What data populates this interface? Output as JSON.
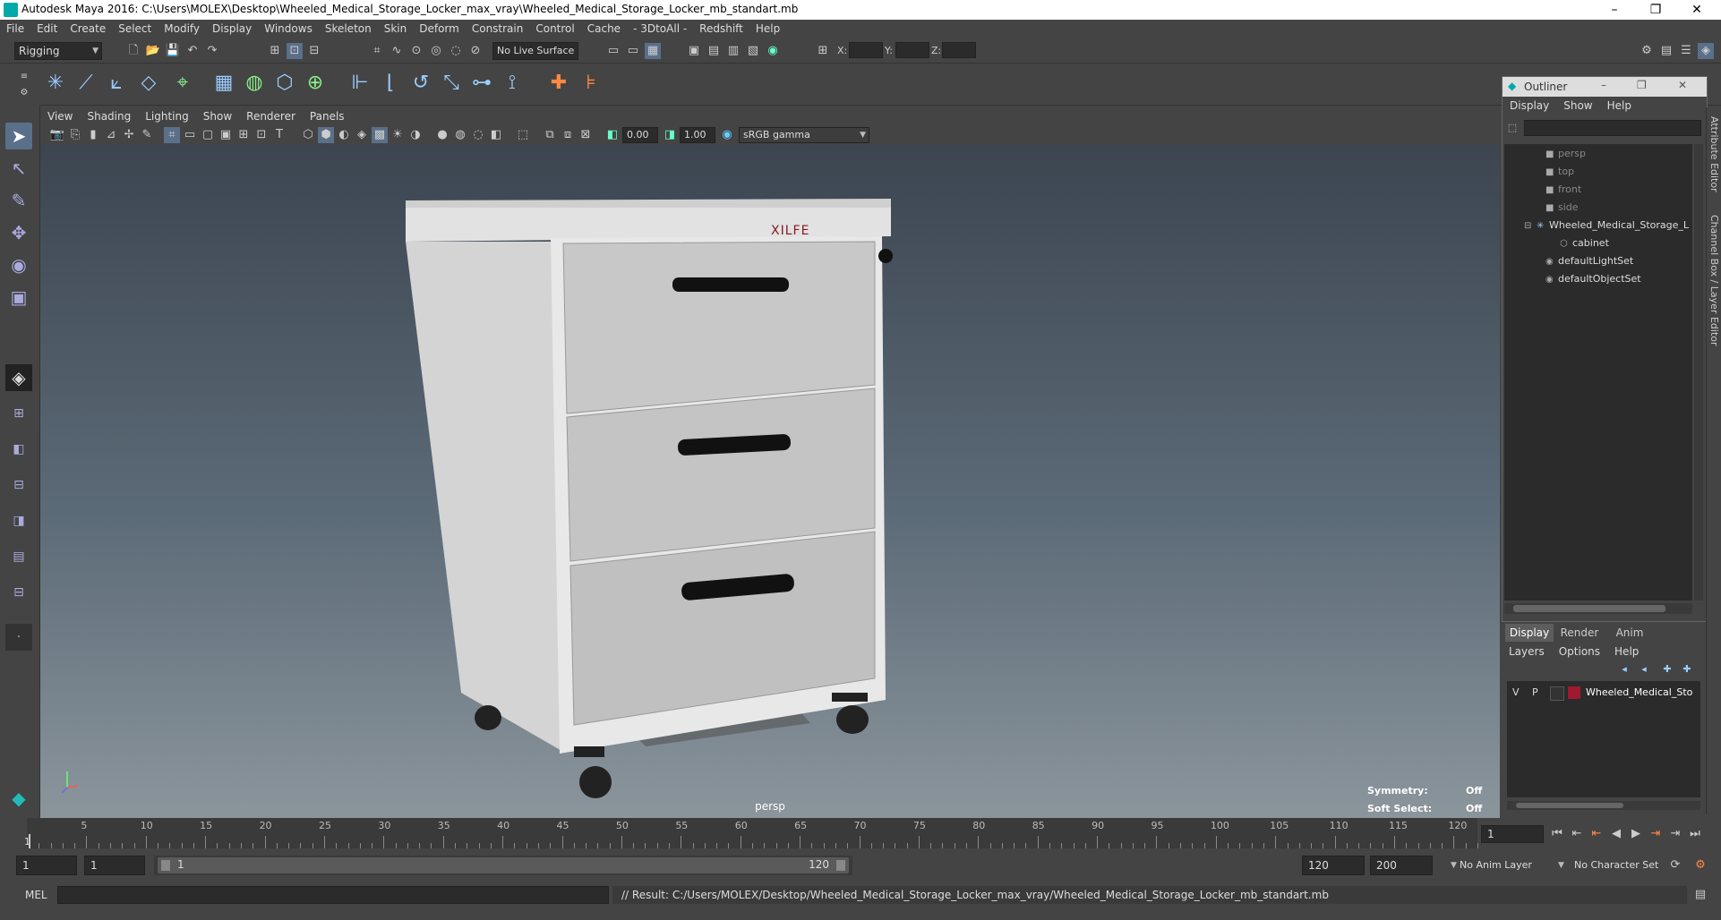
{
  "window": {
    "title": "Autodesk Maya 2016: C:\\Users\\MOLEX\\Desktop\\Wheeled_Medical_Storage_Locker_max_vray\\Wheeled_Medical_Storage_Locker_mb_standart.mb",
    "minimize": "–",
    "restore": "❐",
    "close": "✕"
  },
  "menubar": [
    "File",
    "Edit",
    "Create",
    "Select",
    "Modify",
    "Display",
    "Windows",
    "Skeleton",
    "Skin",
    "Deform",
    "Constrain",
    "Control",
    "Cache",
    "- 3DtoAll -",
    "Redshift",
    "Help"
  ],
  "statusline": {
    "mode": "Rigging",
    "live_surface": "No Live Surface",
    "x_label": "X:",
    "y_label": "Y:",
    "z_label": "Z:"
  },
  "viewport": {
    "menu": [
      "View",
      "Shading",
      "Lighting",
      "Show",
      "Renderer",
      "Panels"
    ],
    "exposure": "0.00",
    "gamma": "1.00",
    "color_space": "sRGB gamma",
    "camera": "persp",
    "hud": {
      "symmetry_label": "Symmetry:",
      "symmetry_value": "Off",
      "soft_select_label": "Soft Select:",
      "soft_select_value": "Off"
    },
    "model_brand": "XILFE"
  },
  "outliner": {
    "title": "Outliner",
    "menu": [
      "Display",
      "Show",
      "Help"
    ],
    "nodes": [
      {
        "label": "persp",
        "dim": true
      },
      {
        "label": "top",
        "dim": true
      },
      {
        "label": "front",
        "dim": true
      },
      {
        "label": "side",
        "dim": true
      },
      {
        "label": "Wheeled_Medical_Storage_L",
        "dim": false
      },
      {
        "label": "cabinet",
        "dim": false
      },
      {
        "label": "defaultLightSet",
        "dim": false
      },
      {
        "label": "defaultObjectSet",
        "dim": false
      }
    ]
  },
  "side_tabs": {
    "attribute_editor": "Attribute Editor",
    "channel_box": "Channel Box / Layer Editor"
  },
  "layer_editor": {
    "tabs": [
      "Display",
      "Render",
      "Anim"
    ],
    "menu": [
      "Layers",
      "Options",
      "Help"
    ],
    "layer": {
      "v": "V",
      "p": "P",
      "name": "Wheeled_Medical_Sto",
      "color": "#a0192e"
    }
  },
  "timeline": {
    "ticks": [
      "5",
      "10",
      "15",
      "20",
      "25",
      "30",
      "35",
      "40",
      "45",
      "50",
      "55",
      "60",
      "65",
      "70",
      "75",
      "80",
      "85",
      "90",
      "95",
      "100",
      "105",
      "110",
      "115",
      "120"
    ],
    "start_label": "1",
    "current_frame": "1"
  },
  "range": {
    "start": "1",
    "playback_start": "1",
    "range_start": "1",
    "range_end": "120",
    "playback_end": "120",
    "end": "200",
    "anim_layer": "No Anim Layer",
    "character_set": "No Character Set"
  },
  "command": {
    "mel": "MEL",
    "result": "// Result: C:/Users/MOLEX/Desktop/Wheeled_Medical_Storage_Locker_max_vray/Wheeled_Medical_Storage_Locker_mb_standart.mb"
  }
}
